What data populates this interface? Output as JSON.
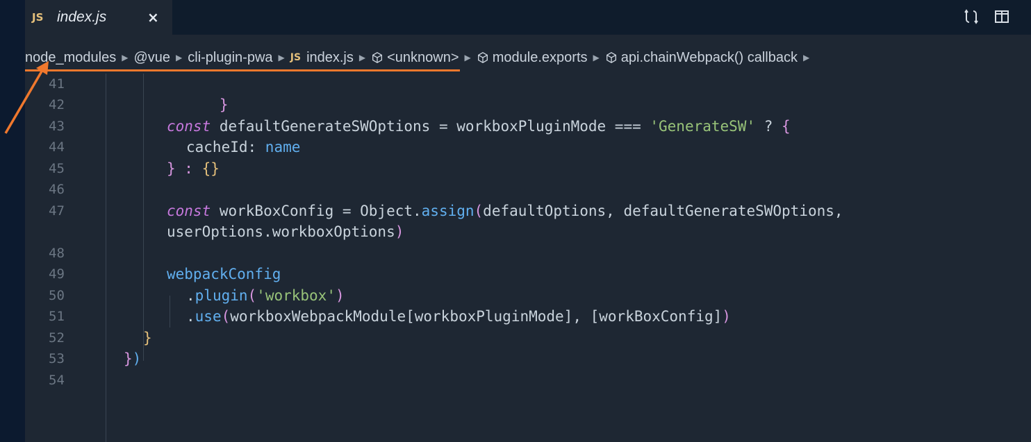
{
  "tab": {
    "badge": "JS",
    "title": "index.js",
    "close": "×"
  },
  "breadcrumb": {
    "items": [
      {
        "label": "node_modules",
        "icon": "none"
      },
      {
        "label": "@vue",
        "icon": "none"
      },
      {
        "label": "cli-plugin-pwa",
        "icon": "none"
      },
      {
        "label": "index.js",
        "icon": "js-file-icon",
        "badge": "JS"
      },
      {
        "label": "<unknown>",
        "icon": "cube-icon"
      },
      {
        "label": "module.exports",
        "icon": "cube-icon"
      },
      {
        "label": "api.chainWebpack() callback",
        "icon": "cube-icon"
      }
    ],
    "separator": "▶"
  },
  "gutter": {
    "lines": [
      "41",
      "42",
      "43",
      "44",
      "45",
      "46",
      "47",
      "",
      "48",
      "49",
      "50",
      "51",
      "52",
      "53",
      "54"
    ]
  },
  "code": {
    "l41": "}",
    "l43_kw": "const",
    "l43_a": " defaultGenerateSWOptions = workboxPluginMode === ",
    "l43_str": "'GenerateSW'",
    "l43_b": " ? ",
    "l43_brace": "{",
    "l44_a": "cacheId: ",
    "l44_b": "name",
    "l45_a": "} : ",
    "l45_b": "{}",
    "l47_kw": "const",
    "l47_a": " workBoxConfig = Object.",
    "l47_fn": "assign",
    "l47_p": "(",
    "l47_b": "defaultOptions, defaultGenerateSWOptions,",
    "l47w_a": "userOptions.workboxOptions",
    "l47w_p": ")",
    "l49": "webpackConfig",
    "l50_dot": ".",
    "l50_fn": "plugin",
    "l50_p1": "(",
    "l50_str": "'workbox'",
    "l50_p2": ")",
    "l51_dot": ".",
    "l51_fn": "use",
    "l51_p1": "(",
    "l51_b": "workboxWebpackModule[workboxPluginMode], [workBoxConfig]",
    "l51_p2": ")",
    "l52": "}",
    "l53_a": "}",
    "l53_b": ")"
  },
  "colors": {
    "accent_underline": "#f0782d",
    "keyword": "#c678dd",
    "function": "#61afef",
    "string": "#98c379",
    "js_badge": "#e5c07b"
  }
}
